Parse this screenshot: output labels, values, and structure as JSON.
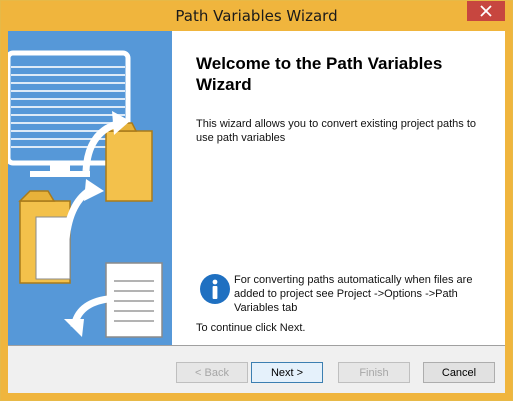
{
  "window": {
    "title": "Path Variables Wizard"
  },
  "icons": {
    "close": "close-icon",
    "info": "info-icon"
  },
  "content": {
    "heading": "Welcome to the Path Variables Wizard",
    "intro": "This wizard allows you to convert existing project paths to use path variables",
    "info": "For converting paths automatically when files are added to project see Project ->Options ->Path Variables tab",
    "continue": "To continue click Next."
  },
  "buttons": {
    "back": "< Back",
    "next": "Next >",
    "finish": "Finish",
    "cancel": "Cancel"
  },
  "colors": {
    "titlebar": "#f0b53d",
    "close": "#c7463f",
    "sidebar": "#5698d8",
    "info": "#1f70c1"
  }
}
